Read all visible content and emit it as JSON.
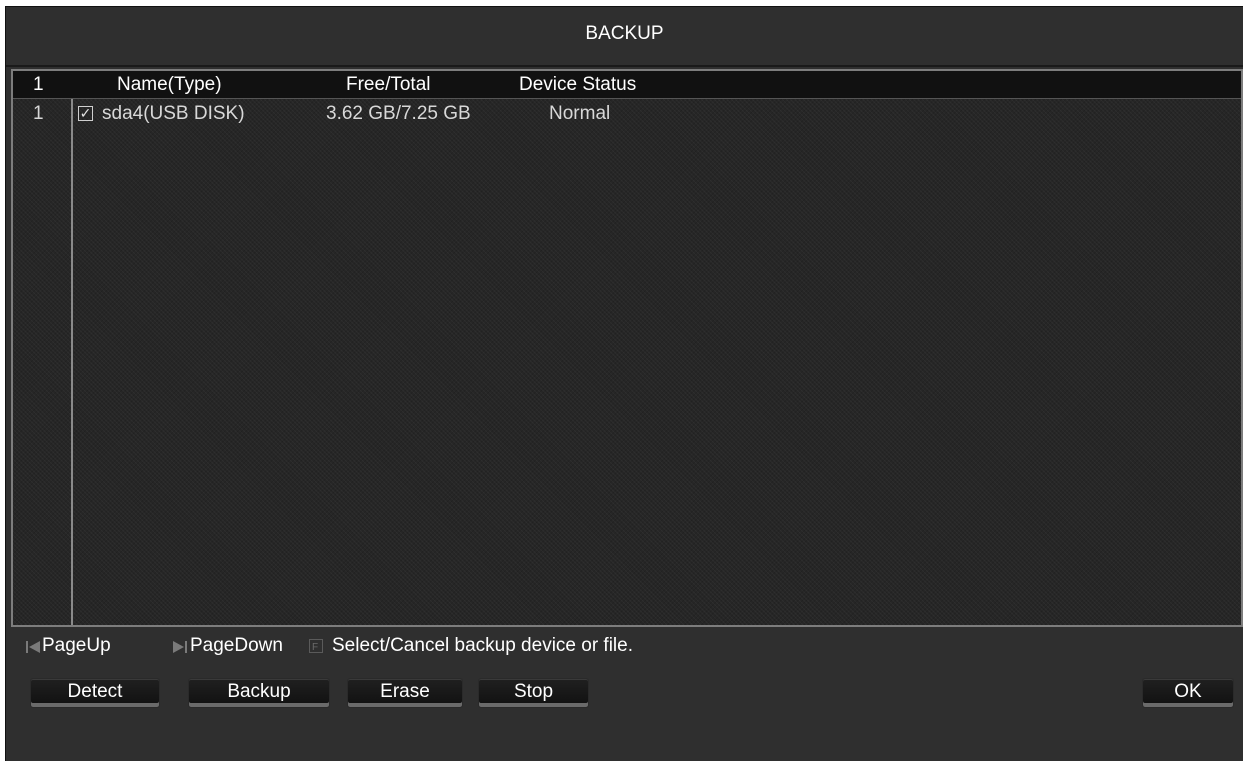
{
  "window": {
    "title": "BACKUP"
  },
  "table": {
    "page_number": "1",
    "columns": [
      "Name(Type)",
      "Free/Total",
      "Device Status"
    ],
    "rows": [
      {
        "index": "1",
        "checked": true,
        "name": "sda4(USB DISK)",
        "free_total": "3.62 GB/7.25 GB",
        "status": "Normal"
      }
    ]
  },
  "hints": {
    "page_up": "PageUp",
    "page_down": "PageDown",
    "select_hint": "Select/Cancel backup device or file."
  },
  "buttons": {
    "detect": "Detect",
    "backup": "Backup",
    "erase": "Erase",
    "stop": "Stop",
    "ok": "OK"
  },
  "colors": {
    "window_bg": "#2f2f2f",
    "panel_bg": "#262626",
    "header_bg": "#111111",
    "text": "#ffffff",
    "row_text": "#d8d8d8"
  },
  "icons": {
    "page_up": "page-up-icon",
    "page_down": "page-down-icon",
    "function_key": "function-key-icon",
    "checkbox": "checkbox-checked-icon"
  }
}
